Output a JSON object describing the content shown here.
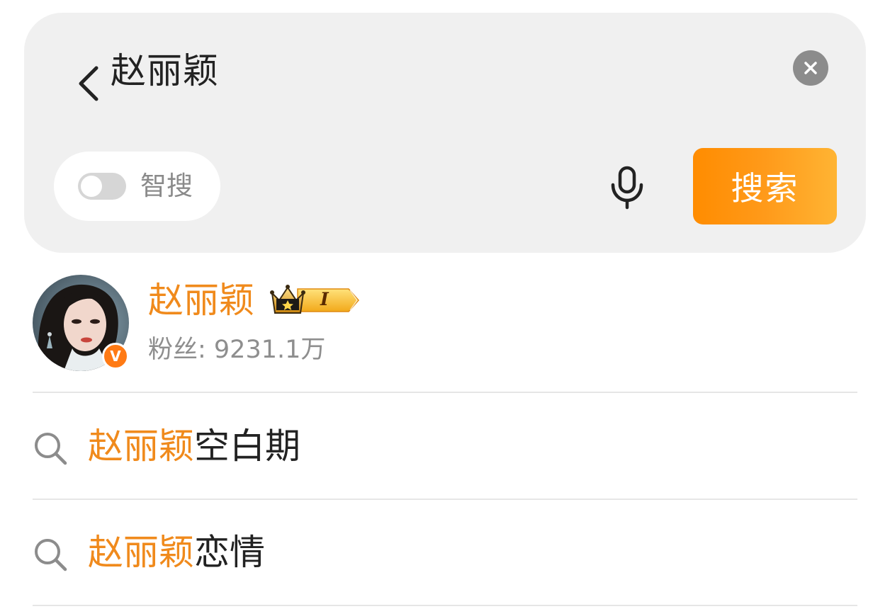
{
  "search_bar": {
    "query": "赵丽颖",
    "smart_search_label": "智搜",
    "smart_search_enabled": false,
    "search_button_label": "搜索",
    "accent_color": "#ff8c00"
  },
  "account_suggestion": {
    "name": "赵丽颖",
    "vip_level": "I",
    "verified": true,
    "verified_mark": "V",
    "followers_label": "粉丝: 9231.1万"
  },
  "suggestions": [
    {
      "highlight": "赵丽颖",
      "rest": "空白期"
    },
    {
      "highlight": "赵丽颖",
      "rest": "恋情"
    }
  ],
  "icons": {
    "back": "chevron-left-icon",
    "clear": "close-icon",
    "mic": "microphone-icon",
    "suggestion": "search-icon",
    "vip": "crown-icon"
  },
  "colors": {
    "highlight": "#f08a1c",
    "panel_bg": "#f0f0f0",
    "text_primary": "#222222",
    "text_secondary": "#8e8e8e"
  }
}
